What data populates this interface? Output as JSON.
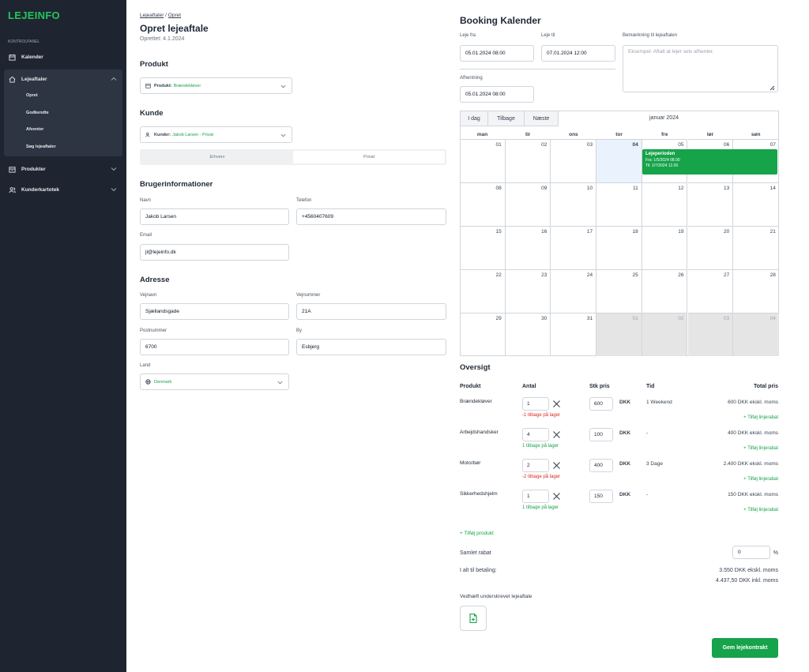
{
  "sidebar": {
    "logo": "LEJEINFO",
    "section_label": "KONTROLPANEL",
    "items": [
      {
        "label": "Kalender",
        "icon": "calendar-icon"
      },
      {
        "label": "Lejeaftaler",
        "icon": "home-icon"
      },
      {
        "label": "Produkter",
        "icon": "box-icon"
      },
      {
        "label": "Kunderkartotek",
        "icon": "users-icon"
      }
    ],
    "sub_items": [
      "Opret",
      "Godkendte",
      "Afventer",
      "Søg lejeaftaler"
    ]
  },
  "header": {
    "crumb_1": "Lejeaftaler",
    "crumb_sep": "/",
    "crumb_2": "Opret",
    "title": "Opret lejeaftale",
    "created": "Oprettet: 4.1.2024"
  },
  "produkt": {
    "heading": "Produkt",
    "select_label": "Produkt:",
    "select_value": "Brændekløver"
  },
  "kunde": {
    "heading": "Kunde",
    "select_label": "Kunder:",
    "select_value": "Jakob Larsen - Privat",
    "toggle": [
      "Erhverv",
      "Privat"
    ],
    "toggle_active": "Privat"
  },
  "brugerinfo": {
    "heading": "Brugerinformationer",
    "navn_label": "Navn",
    "navn": "Jakob Larsen",
    "telefon_label": "Telefon",
    "telefon": "+4560407609",
    "email_label": "Email",
    "email": "jl@lejeinfo.dk"
  },
  "adresse": {
    "heading": "Adresse",
    "vejnavn_label": "Vejnavn",
    "vejnavn": "Sjællandsgade",
    "vejnummer_label": "Vejnummer",
    "vejnummer": "21A",
    "postnummer_label": "Postnummer",
    "postnummer": "6700",
    "by_label": "By",
    "by": "Esbjerg",
    "land_label": "Land",
    "land": "Denmark"
  },
  "booking": {
    "title": "Booking Kalender",
    "leje_fra_label": "Leje fra",
    "leje_fra": "05.01.2024 08:00",
    "leje_til_label": "Leje til",
    "leje_til": "07.01.2024 12:00",
    "bemaerkning_label": "Bemærkning til lejeaftalen",
    "bemaerkning_placeholder": "Eksempel: Aftalt at lejer selv afhenter.",
    "afhentning_label": "Afhentning",
    "afhentning": "05.01.2024 08:00",
    "buttons": [
      "I dag",
      "Tilbage",
      "Næste"
    ],
    "month": "januar 2024",
    "weekdays": [
      "man",
      "tir",
      "ons",
      "tor",
      "fre",
      "lør",
      "søn"
    ],
    "days": [
      "01",
      "02",
      "03",
      "04",
      "05",
      "06",
      "07",
      "08",
      "09",
      "10",
      "11",
      "12",
      "13",
      "14",
      "15",
      "16",
      "17",
      "18",
      "19",
      "20",
      "21",
      "22",
      "23",
      "24",
      "25",
      "26",
      "27",
      "28",
      "29",
      "30",
      "31",
      "01",
      "02",
      "03",
      "04"
    ],
    "event": {
      "title": "Lejeperioden",
      "fra": "Fra: 1/5/2024 08.00",
      "til": "Til: 1/7/2024 12.00"
    }
  },
  "oversigt": {
    "title": "Oversigt",
    "headers": [
      "Produkt",
      "Antal",
      "Stk pris",
      "Tid",
      "Total pris"
    ],
    "currency": "DKK",
    "add_discount": "+ Tilføj linjerabat",
    "rows": [
      {
        "produkt": "Brændekløver",
        "antal": "1",
        "stock": "-1 tilbage på lager",
        "stock_neg": true,
        "pris": "600",
        "tid": "1 Weekend",
        "total": "600 DKK ekskl. moms"
      },
      {
        "produkt": "Arbejdshandsker",
        "antal": "4",
        "stock": "1 tilbage på lager",
        "stock_neg": false,
        "pris": "100",
        "tid": "-",
        "total": "400 DKK ekskl. moms"
      },
      {
        "produkt": "Motorbør",
        "antal": "2",
        "stock": "-2 tilbage på lager",
        "stock_neg": true,
        "pris": "400",
        "tid": "3 Dage",
        "total": "2.400 DKK ekskl. moms"
      },
      {
        "produkt": "Sikkerhedshjelm",
        "antal": "1",
        "stock": "1 tilbage på lager",
        "stock_neg": false,
        "pris": "150",
        "tid": "-",
        "total": "150 DKK ekskl. moms"
      }
    ],
    "add_product": "+ Tilføj produkt",
    "samlet_rabat_label": "Samlet rabat",
    "samlet_rabat": "0",
    "percent": "%",
    "betaling_label": "I alt til betaling:",
    "betaling_ex": "3.550 DKK ekskl. moms",
    "betaling_inkl": "4.437,50 DKK inkl. moms",
    "attach_label": "Vedhæft underskrevet lejeaftale",
    "save_label": "Gem lejekontrakt"
  },
  "colors": {
    "accent": "#16a34a",
    "sidebar_bg": "#1f2530",
    "danger": "#dc2626"
  }
}
